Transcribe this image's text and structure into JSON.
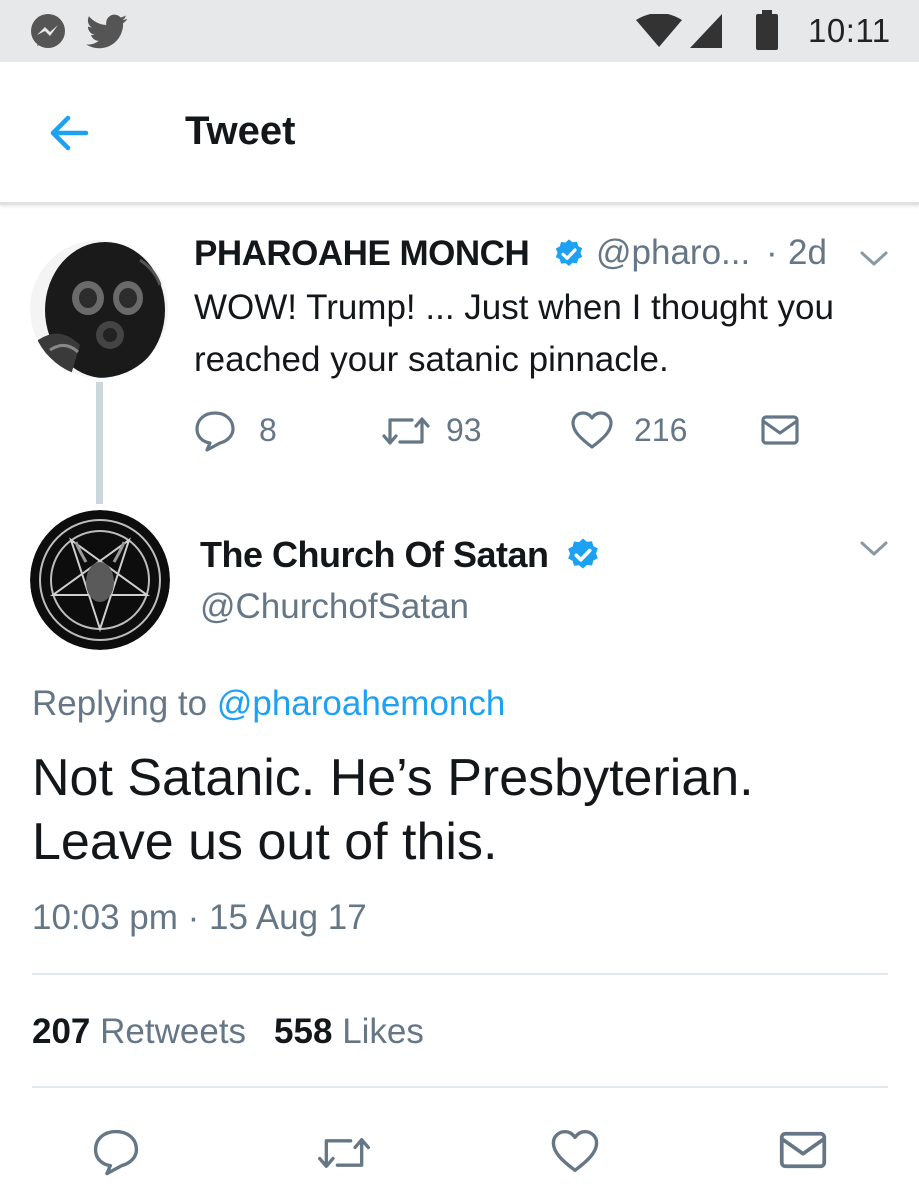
{
  "status_bar": {
    "time": "10:11",
    "icons": [
      "messenger-icon",
      "twitter-bird-icon",
      "wifi-icon",
      "cell-signal-icon",
      "battery-icon"
    ]
  },
  "header": {
    "back_icon": "arrow-left-icon",
    "title": "Tweet"
  },
  "parent_tweet": {
    "name": "PHAROAHE MONCH",
    "verified": true,
    "handle": "@pharo...",
    "dot": "·",
    "time": "2d",
    "text": "WOW! Trump! ... Just when I thought you reached your satanic pinnacle.",
    "actions": {
      "replies": "8",
      "retweets": "93",
      "likes": "216"
    }
  },
  "main_tweet": {
    "name": "The Church Of Satan",
    "verified": true,
    "handle": "@ChurchofSatan",
    "replying_prefix": "Replying to",
    "replying_to": "@pharoahemonch",
    "text": "Not Satanic. He’s Presbyterian. Leave us out of this.",
    "timestamp": "10:03 pm · 15 Aug 17",
    "stats": {
      "retweets_count": "207",
      "retweets_label": "Retweets",
      "likes_count": "558",
      "likes_label": "Likes"
    }
  },
  "colors": {
    "accent": "#1da1f2",
    "secondary_text": "#657786",
    "primary_text": "#14171a",
    "status_bar_bg": "#e7e8ea",
    "divider": "#e1e8ed"
  }
}
